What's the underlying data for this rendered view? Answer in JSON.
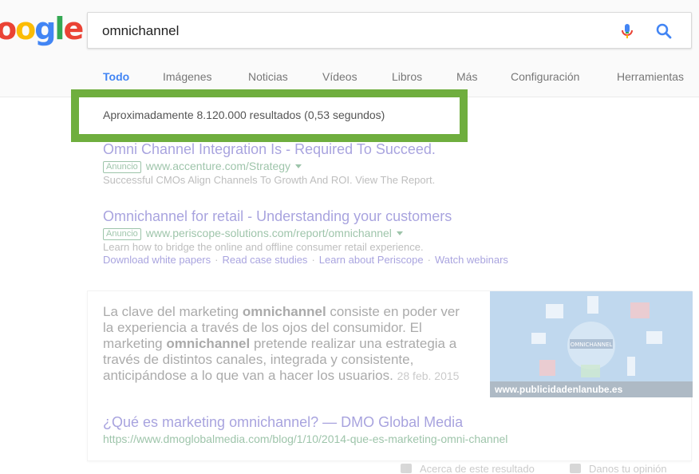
{
  "logo": {
    "text": "ogle",
    "alt": "Google"
  },
  "search": {
    "query": "omnichannel"
  },
  "tabs": [
    {
      "label": "Todo"
    },
    {
      "label": "Imágenes"
    },
    {
      "label": "Noticias"
    },
    {
      "label": "Vídeos"
    },
    {
      "label": "Libros"
    },
    {
      "label": "Más"
    },
    {
      "label": "Configuración"
    },
    {
      "label": "Herramientas"
    }
  ],
  "results_stats": "Aproximadamente 8.120.000 resultados (0,53 segundos)",
  "ads": [
    {
      "title": "Omni Channel Integration Is - Required To Succeed.",
      "badge": "Anuncio",
      "url": "www.accenture.com/Strategy",
      "description": "Successful CMOs Align Channels To Growth And ROI. View The Report."
    },
    {
      "title": "Omnichannel for retail - Understanding your customers",
      "badge": "Anuncio",
      "url": "www.periscope-solutions.com/report/omnichannel",
      "description": "Learn how to bridge the online and offline consumer retail experience.",
      "sitelinks": [
        "Download white papers",
        "Read case studies",
        "Learn about Periscope",
        "Watch webinars"
      ]
    }
  ],
  "snippet": {
    "text_parts": [
      "La clave del marketing ",
      "omnichannel",
      " consiste en poder ver la experiencia a través de los ojos del consumidor. El marketing ",
      "omnichannel",
      " pretende realizar una estrategia a través de distintos canales, integrada y consistente, anticipándose a lo que van a hacer los usuarios."
    ],
    "date": "28 feb. 2015",
    "image_caption": "www.publicidadenlanube.es",
    "image_label": "OMNICHANNEL",
    "link_title": "¿Qué es marketing omnichannel? — DMO Global Media",
    "link_url": "https://www.dmoglobalmedia.com/blog/1/10/2014-que-es-marketing-omni-channel"
  },
  "footer": {
    "about": "Acerca de este resultado",
    "feedback": "Danos tu opinión"
  },
  "colors": {
    "highlight": "#6fae3e",
    "link": "#1a0dab",
    "url": "#006621",
    "active_tab": "#4285f4"
  }
}
